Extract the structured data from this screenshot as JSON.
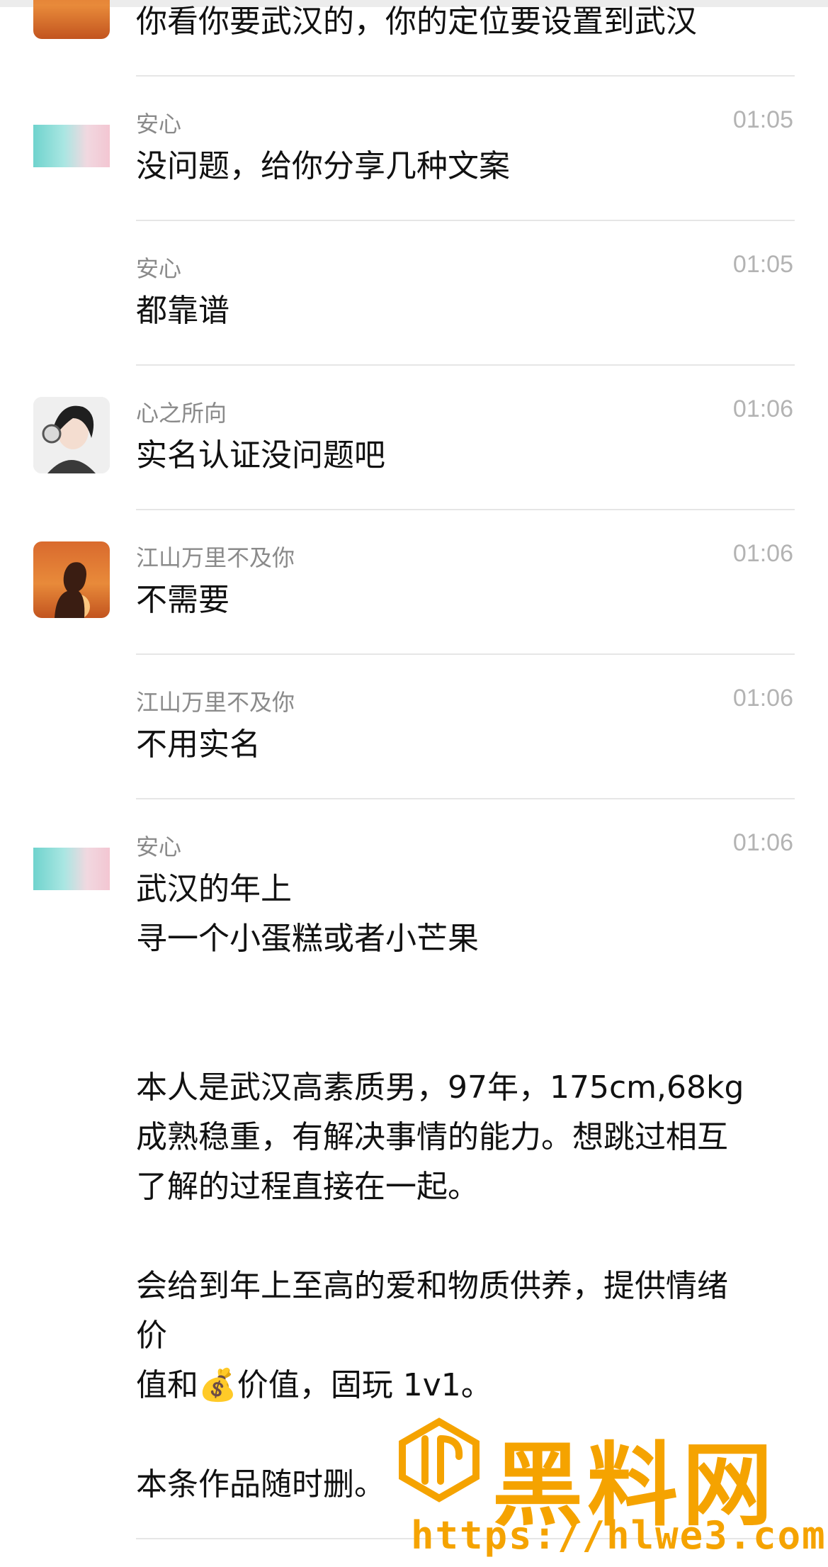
{
  "messages": [
    {
      "name": "",
      "time": "",
      "text": "你看你要武汉的，你的定位要设置到武汉",
      "avatar": "avatar-sunset"
    },
    {
      "name": "安心",
      "time": "01:05",
      "text": "没问题，给你分享几种文案",
      "avatar": "avatar-teal"
    },
    {
      "name": "安心",
      "time": "01:05",
      "text": "都靠谱",
      "avatar": ""
    },
    {
      "name": "心之所向",
      "time": "01:06",
      "text": "实名认证没问题吧",
      "avatar": "avatar-anime"
    },
    {
      "name": "江山万里不及你",
      "time": "01:06",
      "text": "不需要",
      "avatar": "avatar-sunset"
    },
    {
      "name": "江山万里不及你",
      "time": "01:06",
      "text": "不用实名",
      "avatar": ""
    },
    {
      "name": "安心",
      "time": "01:06",
      "text_lines": [
        "武汉的年上",
        "寻一个小蛋糕或者小芒果",
        "",
        "",
        "本人是武汉高素质男，97年，175cm,68kg",
        "成熟稳重，有解决事情的能力。想跳过相互",
        "了解的过程直接在一起。",
        "",
        "会给到年上至高的爱和物质供养，提供情绪",
        "价",
        "值和💰价值，固玩 1v1。",
        "",
        "本条作品随时删。"
      ],
      "avatar": "avatar-teal"
    }
  ],
  "watermark": {
    "title": "黑料网",
    "url": "https://hlwe3.com",
    "color": "#f5a300"
  }
}
